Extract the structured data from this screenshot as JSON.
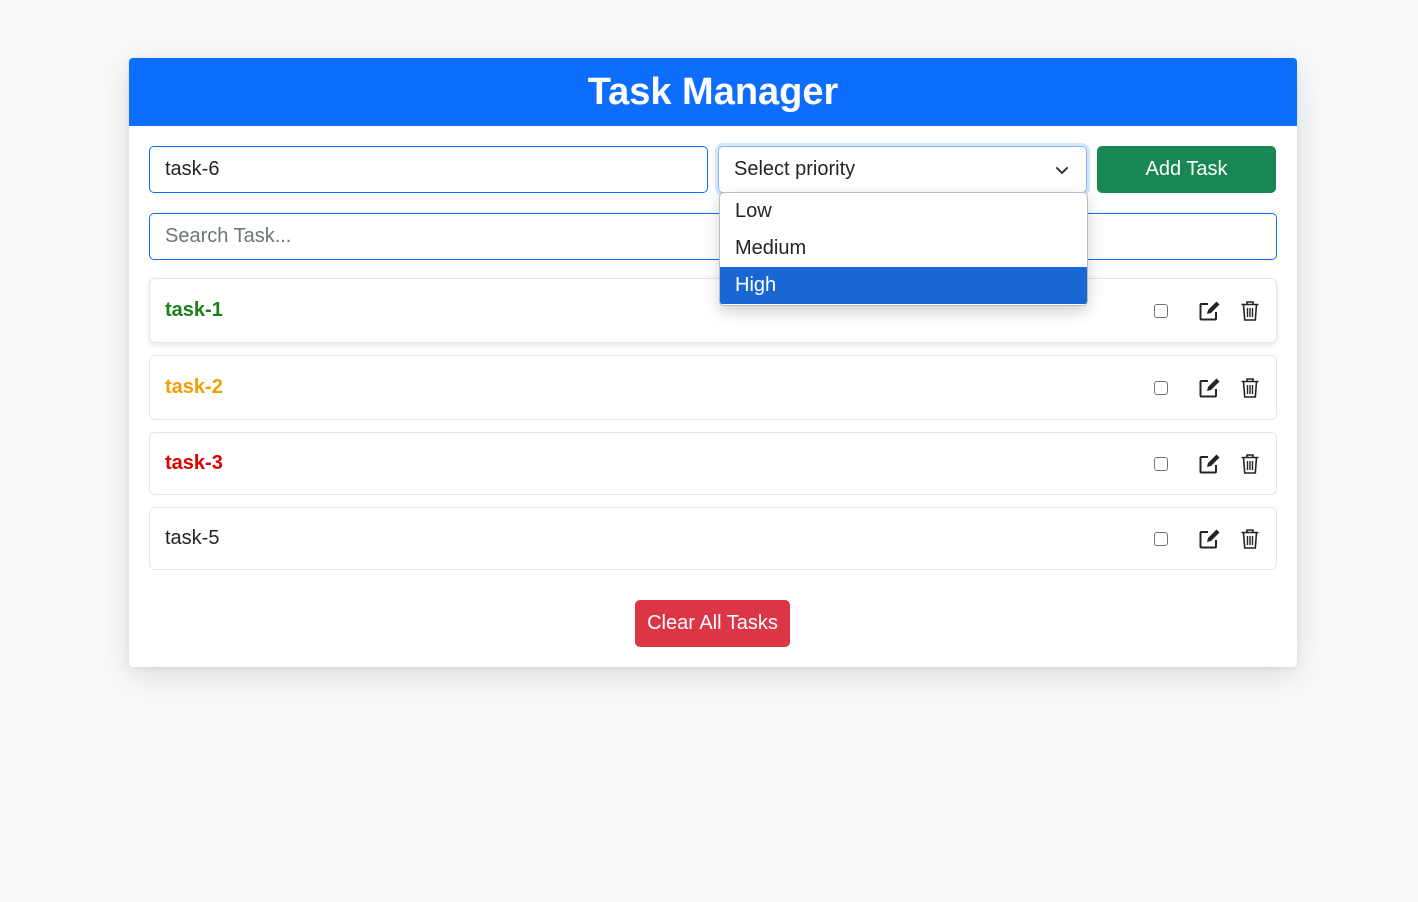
{
  "header": {
    "title": "Task Manager"
  },
  "form": {
    "task_value": "task-6",
    "priority_label": "Select priority",
    "add_button_label": "Add Task",
    "search_placeholder": "Search Task..."
  },
  "priority_dropdown": {
    "options": [
      {
        "label": "Low",
        "selected": false
      },
      {
        "label": "Medium",
        "selected": false
      },
      {
        "label": "High",
        "selected": true
      }
    ]
  },
  "tasks": [
    {
      "name": "task-1",
      "priority": "low",
      "color": "#198019",
      "done": false
    },
    {
      "name": "task-2",
      "priority": "medium",
      "color": "#f0a000",
      "done": false
    },
    {
      "name": "task-3",
      "priority": "high",
      "color": "#e00000",
      "done": false
    },
    {
      "name": "task-5",
      "priority": "",
      "color": "#212529",
      "done": false
    }
  ],
  "footer": {
    "clear_button_label": "Clear All Tasks"
  },
  "colors": {
    "primary": "#0d6efd",
    "success": "#198754",
    "danger": "#dc3545",
    "option_highlight": "#1967d2"
  },
  "icons": {
    "edit": "edit-icon",
    "delete": "trash-icon",
    "dropdown": "chevron-down-icon"
  }
}
